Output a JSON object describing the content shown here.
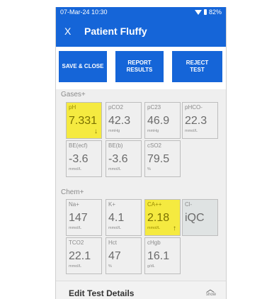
{
  "status_bar": {
    "time": "07-Mar-24 10:30",
    "battery": "82%"
  },
  "app_bar": {
    "close_label": "X",
    "title": "Patient Fluffy"
  },
  "actions": [
    {
      "label": "SAVE & CLOSE"
    },
    {
      "label": "REPORT\nRESULTS"
    },
    {
      "label": "REJECT\nTEST"
    }
  ],
  "sections": {
    "gases": "Gases+",
    "chem": "Chem+"
  },
  "gases": [
    {
      "label": "pH",
      "value": "7.331",
      "unit": "",
      "flag": "low"
    },
    {
      "label": "pCO2",
      "value": "42.3",
      "unit": "mmHg"
    },
    {
      "label": "pC23",
      "value": "46.9",
      "unit": "mmHg"
    },
    {
      "label": "pHCO-",
      "value": "22.3",
      "unit": "mmol/L"
    },
    {
      "label": "BE(ecf)",
      "value": "-3.6",
      "unit": "mmol/L"
    },
    {
      "label": "BE(b)",
      "value": "-3.6",
      "unit": "mmol/L"
    },
    {
      "label": "cSO2",
      "value": "79.5",
      "unit": "%"
    }
  ],
  "chem": [
    {
      "label": "Na+",
      "value": "147",
      "unit": "mmol/L"
    },
    {
      "label": "K+",
      "value": "4.1",
      "unit": "mmol/L"
    },
    {
      "label": "CA++",
      "value": "2.18",
      "unit": "mmol/L",
      "flag": "high"
    },
    {
      "label": "Cl-",
      "value": "iQC",
      "unit": ""
    },
    {
      "label": "TCO2",
      "value": "22.1",
      "unit": "mmol/L"
    },
    {
      "label": "Hct",
      "value": "47",
      "unit": "%"
    },
    {
      "label": "cHgb",
      "value": "16.1",
      "unit": "g/dL"
    }
  ],
  "bottom": {
    "label": "Edit Test Details",
    "show": "show"
  },
  "colors": {
    "primary": "#1565d8",
    "highlight": "#f5ea40",
    "background": "#efefef"
  }
}
